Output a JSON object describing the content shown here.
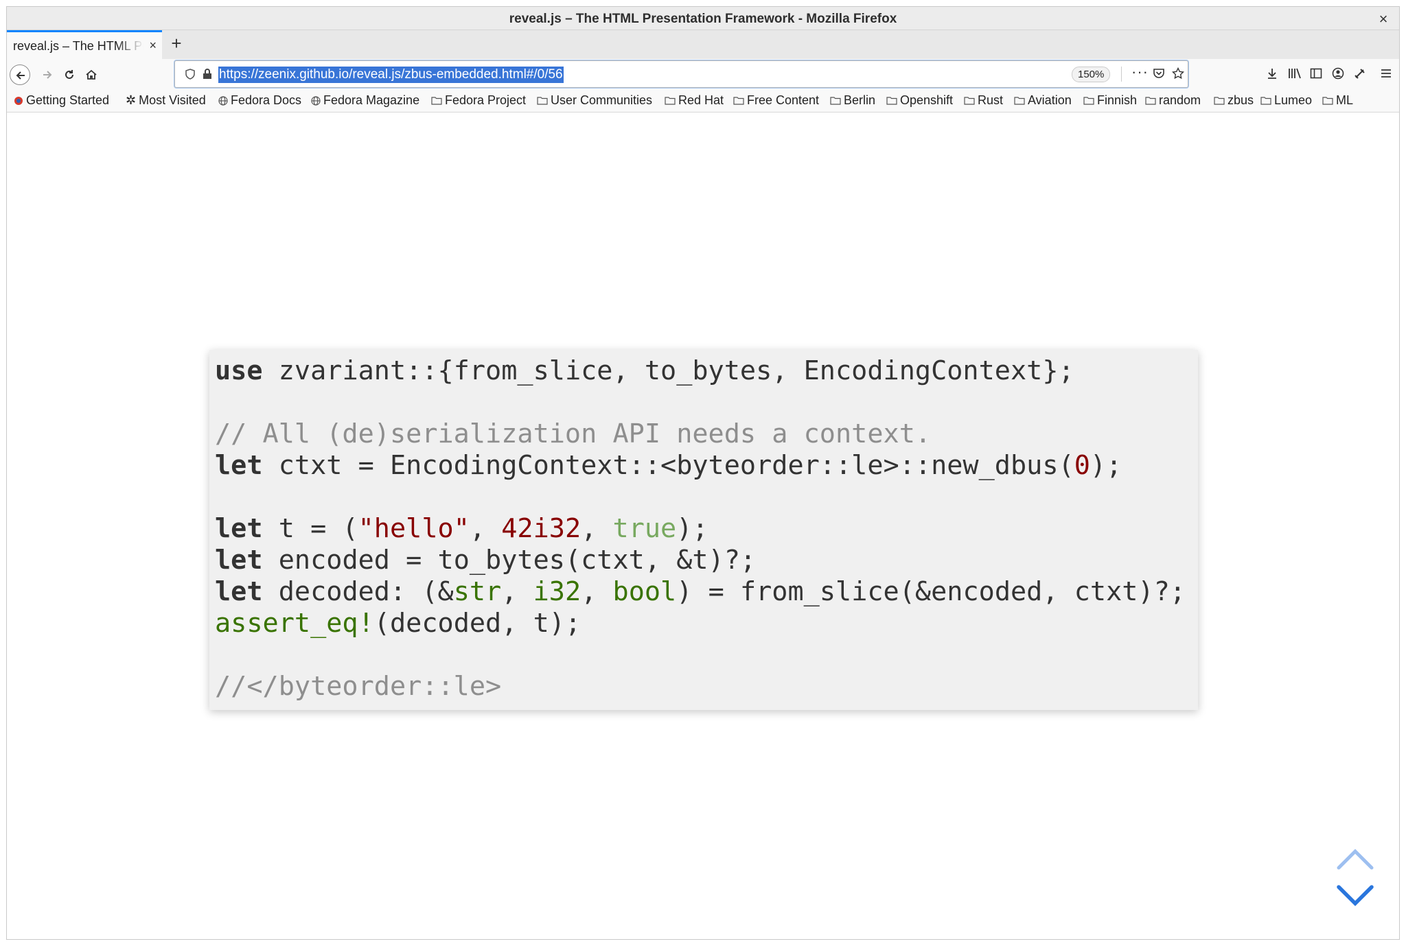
{
  "window": {
    "title": "reveal.js – The HTML Presentation Framework - Mozilla Firefox",
    "close_glyph": "×"
  },
  "tabs": [
    {
      "label": "reveal.js – The HTML Presentation Framework",
      "close_glyph": "×"
    }
  ],
  "new_tab_glyph": "+",
  "url": "https://zeenix.github.io/reveal.js/zbus-embedded.html#/0/56",
  "zoom": "150%",
  "url_more": "···",
  "bookmarks": [
    {
      "label": "Getting Started",
      "icon": "fedora-icon"
    },
    {
      "label": "Most Visited",
      "icon": "gear-icon"
    },
    {
      "label": "Fedora Docs",
      "icon": "globe-icon"
    },
    {
      "label": "Fedora Magazine",
      "icon": "globe-icon"
    },
    {
      "label": "Fedora Project",
      "icon": "folder-icon"
    },
    {
      "label": "User Communities",
      "icon": "folder-icon"
    },
    {
      "label": "Red Hat",
      "icon": "folder-icon"
    },
    {
      "label": "Free Content",
      "icon": "folder-icon"
    },
    {
      "label": "Berlin",
      "icon": "folder-icon"
    },
    {
      "label": "Openshift",
      "icon": "folder-icon"
    },
    {
      "label": "Rust",
      "icon": "folder-icon"
    },
    {
      "label": "Aviation",
      "icon": "folder-icon"
    },
    {
      "label": "Finnish",
      "icon": "folder-icon"
    },
    {
      "label": "random",
      "icon": "folder-icon"
    },
    {
      "label": "zbus",
      "icon": "folder-icon"
    },
    {
      "label": "Lumeo",
      "icon": "folder-icon"
    },
    {
      "label": "ML",
      "icon": "folder-icon"
    }
  ],
  "code": {
    "line1": {
      "kw": "use",
      "rest": " zvariant::{from_slice, to_bytes, EncodingContext};"
    },
    "line3": "// All (de)serialization API needs a context.",
    "line4": {
      "kw": "let",
      "a": " ctxt = EncodingContext::<byteorder::le>::new_dbus(",
      "num": "0",
      "b": ");"
    },
    "line6": {
      "kw": "let",
      "a": " t = (",
      "str": "\"hello\"",
      "b": ", ",
      "num": "42i32",
      "c": ", ",
      "lit": "true",
      "d": ");"
    },
    "line7": {
      "kw": "let",
      "a": " encoded = to_bytes(ctxt, &t)?;"
    },
    "line8": {
      "kw": "let",
      "a": " decoded: (&",
      "ty1": "str",
      "b": ", ",
      "ty2": "i32",
      "c": ", ",
      "ty3": "bool",
      "d": ") = from_slice(&encoded, ctxt)?;"
    },
    "line9": {
      "mac": "assert_eq!",
      "a": "(decoded, t);"
    },
    "line11": "//</byteorder::le>"
  },
  "colors": {
    "accent": "#0a84ff",
    "url_highlight": "#3875d7",
    "progress": "#2a76dd",
    "code_bg": "#f0f0f0"
  },
  "progress": {
    "fraction": 0.66
  }
}
